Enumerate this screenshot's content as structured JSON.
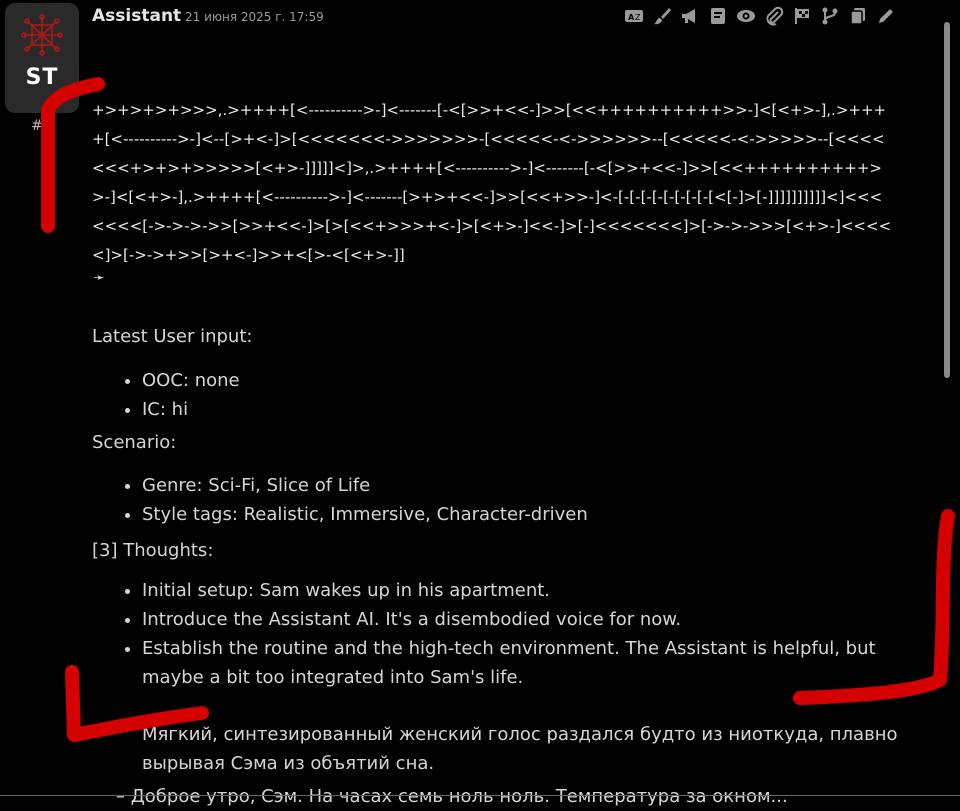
{
  "message": {
    "avatar_text": "ST",
    "number": "#",
    "author": "Assistant",
    "timestamp": "21 июня 2025 г. 17:59"
  },
  "toolbar": {
    "icons": [
      "translate-icon",
      "brush-icon",
      "megaphone-icon",
      "note-icon",
      "eye-icon",
      "paperclip-icon",
      "flag-icon",
      "branch-icon",
      "copy-icon",
      "edit-icon"
    ]
  },
  "code": {
    "text": "+>+>+>+>>>,.>++++[<---------->-]<-------[-<[>>+<<-]>>[<<++++++++++>>-]<[<+>-],.>++++[<---------->-]<--[>+<-]>[<<<<<<<->>>>>>>-[<<<<<-<->>>>>>--[<<<<<-<->>>>>--[<<<<<<<+>+>+>>>>>[<+>-]]]]]<]>,.>++++[<---------->-]<-------[-<[>>+<<-]>>[<<++++++++++>>-]<[<+>-],.>++++[<---------->-]<-------[>+>+<<-]>>[<<+>>-]<-[-[-[-[-[-[-[-[-[<[-]>[-]]]]]]]]]]<]<<<<<<<[->->->->>[>>+<<-]>[>[<<+>>>+<-]>[<+>-]<<-]>[-]<<<<<<<]>[->->->>>[<+>-]<<<<<]>[->->+>>[>+<-]>>+<[>-<[<+>-]]"
  },
  "arrow_glyph": "➛",
  "content": {
    "latest_heading": "Latest User input:",
    "latest_items": [
      "OOC: none",
      "IC: hi"
    ],
    "scenario_heading": "Scenario:",
    "scenario_items": [
      "Genre: Sci-Fi, Slice of Life",
      "Style tags: Realistic, Immersive, Character-driven"
    ],
    "thoughts_heading": "[3] Thoughts:",
    "thoughts_items": [
      "Initial setup: Sam wakes up in his apartment.",
      "Introduce the Assistant AI. It's a disembodied voice for now.",
      "Establish the routine and the high-tech environment. The Assistant is helpful, but maybe a bit too integrated into Sam's life."
    ],
    "narration_1": "Мягкий, синтезированный женский голос раздался будто из ниоткуда, плавно вырывая Сэма из объятий сна.",
    "narration_2": "– Доброе утро, Сэм. На часах семь ноль ноль. Температура за окном..."
  },
  "colors": {
    "background": "#000000",
    "text": "#d6d6d6",
    "annotation_red": "#d40000",
    "avatar_bg": "#2a2a2a"
  }
}
